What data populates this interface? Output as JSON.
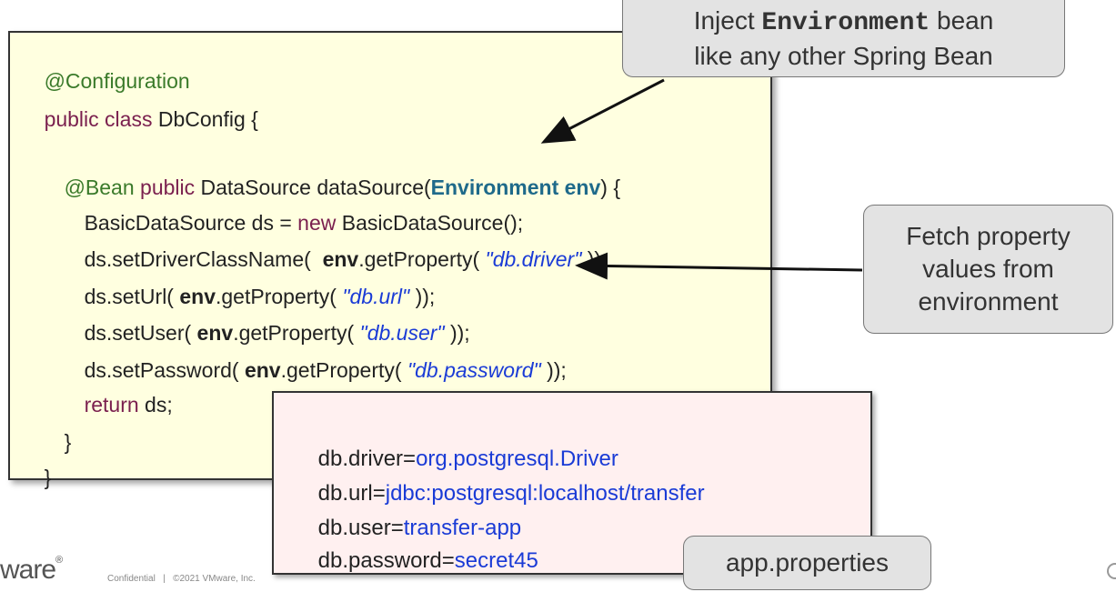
{
  "code": {
    "annotation_config": "@Configuration",
    "class_kw": "public class",
    "class_name": " DbConfig {",
    "bean_annotation": "@Bean",
    "method_kw": " public",
    "method_sig": " DataSource dataSource(",
    "env_param": "Environment env",
    "method_end": ") {",
    "ds_decl_1": "BasicDataSource ds = ",
    "new_kw": "new",
    "ds_decl_2": " BasicDataSource();",
    "line_driver_1": "ds.setDriverClassName(  ",
    "line_url_1": "ds.setUrl( ",
    "line_user_1": "ds.setUser( ",
    "line_pass_1": "ds.setPassword( ",
    "env_ref": "env",
    "get_prop": ".getProperty( ",
    "str_driver": "\"db.driver\"",
    "str_url": "\"db.url\"",
    "str_user": "\"db.user\"",
    "str_password": "\"db.password\"",
    "close_call": " ));",
    "return_kw": "return",
    "return_rest": " ds;",
    "close_method": "}",
    "close_class": "}"
  },
  "properties": {
    "driver_key": "db.driver=",
    "driver_val": "org.postgresql.Driver",
    "url_key": "db.url=",
    "url_val": "jdbc:postgresql:localhost/transfer",
    "user_key": "db.user=",
    "user_val": "transfer-app",
    "password_key": "db.password=",
    "password_val": "secret45"
  },
  "callouts": {
    "inject_pre": "Inject ",
    "inject_code": "Environment",
    "inject_post": "  bean",
    "inject_line2": "like any other Spring Bean",
    "fetch_line1": "Fetch property",
    "fetch_line2": "values from",
    "fetch_line3": "environment",
    "file_label": "app.properties"
  },
  "footer": {
    "logo_text": "ware",
    "reg_mark": "®",
    "confidential": "Confidential   |   ©2021 VMware, Inc."
  },
  "colors": {
    "code_bg": "#ffffe0",
    "props_bg": "#fff0f0",
    "keyword": "#7a1f4e",
    "annotation": "#3a7a2a",
    "env": "#1f6a8a",
    "string": "#1a3bd6",
    "callout_bg": "#e3e3e3"
  }
}
